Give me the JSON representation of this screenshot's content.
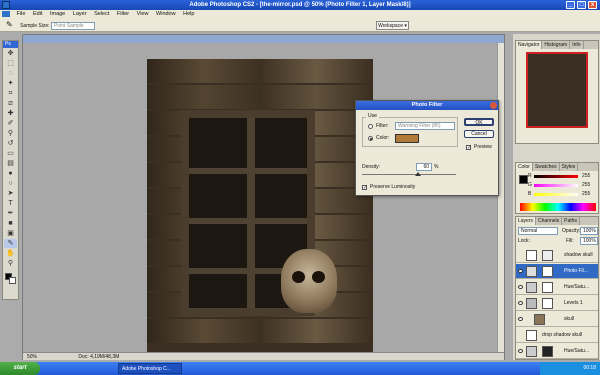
{
  "window": {
    "title": "Adobe Photoshop CS2 - [the-mirror.psd @ 50% (Photo Filter 1, Layer Mask/8)]",
    "minimize": "_",
    "maximize": "□",
    "close": "x"
  },
  "menu": [
    "File",
    "Edit",
    "Image",
    "Layer",
    "Select",
    "Filter",
    "View",
    "Window",
    "Help"
  ],
  "options_bar": {
    "sample_size_label": "Sample Size:",
    "sample_size_value": "Point Sample",
    "workspace_label": "Workspace ▾"
  },
  "toolbox": {
    "header": "Ps",
    "tools": [
      "move-icon",
      "marquee-icon",
      "lasso-icon",
      "magic-wand-icon",
      "crop-icon",
      "slice-icon",
      "healing-icon",
      "brush-icon",
      "stamp-icon",
      "history-brush-icon",
      "eraser-icon",
      "gradient-icon",
      "blur-icon",
      "dodge-icon",
      "path-select-icon",
      "type-icon",
      "pen-icon",
      "shape-icon",
      "notes-icon",
      "eyedropper-icon",
      "hand-icon",
      "zoom-icon"
    ],
    "foreground_color": "#000000",
    "background_color": "#ffffff"
  },
  "document": {
    "status_zoom": "50%",
    "status_doc": "Doc: 4,19M/48,3M"
  },
  "dialog": {
    "title": "Photo Filter",
    "use_label": "Use",
    "filter_label": "Filter:",
    "filter_value": "Warming Filter (85)",
    "color_label": "Color:",
    "color_swatch": "#b07a3a",
    "density_label": "Density:",
    "density_value": "60",
    "density_unit": "%",
    "density_level": 0.6,
    "preserve_label": "Preserve Luminosity",
    "preserve_checked": true,
    "ok": "OK",
    "cancel": "Cancel",
    "preview": "Preview",
    "preview_checked": true
  },
  "navigator": {
    "tabs": [
      "Navigator",
      "Histogram",
      "Info"
    ],
    "active_tab": 0
  },
  "color_panel": {
    "tabs": [
      "Color",
      "Swatches",
      "Styles"
    ],
    "channels": [
      {
        "label": "R",
        "value": "255",
        "color": "#ff0000"
      },
      {
        "label": "G",
        "value": "255",
        "color": "#00c000"
      },
      {
        "label": "B",
        "value": "255",
        "color": "#0000ff"
      }
    ]
  },
  "layers_panel": {
    "tabs": [
      "Layers",
      "Channels",
      "Paths"
    ],
    "blend_mode": "Normal",
    "opacity_label": "Opacity:",
    "opacity_value": "100%",
    "lock_label": "Lock:",
    "fill_label": "Fill:",
    "fill_value": "100%",
    "layers": [
      {
        "name": "shadow skull",
        "visible": false,
        "active": false
      },
      {
        "name": "Photo Fil...",
        "visible": true,
        "active": true
      },
      {
        "name": "Hue/Satu...",
        "visible": true,
        "active": false
      },
      {
        "name": "Levels 1",
        "visible": true,
        "active": false
      },
      {
        "name": "skull",
        "visible": true,
        "active": false
      },
      {
        "name": "drop shadow skull",
        "visible": false,
        "active": false
      },
      {
        "name": "Hue/Satu...",
        "visible": true,
        "active": false
      }
    ]
  },
  "taskbar": {
    "start": "start",
    "task_label": "Adobe Photoshop C...",
    "clock": "00:18"
  }
}
